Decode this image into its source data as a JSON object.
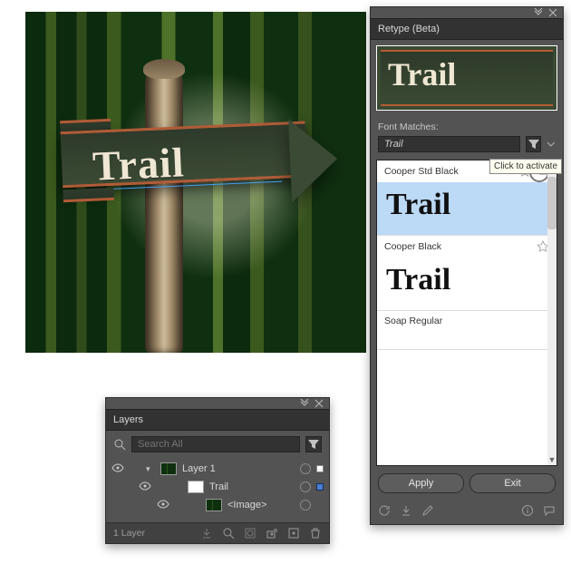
{
  "canvas": {
    "sign_text": "Trail"
  },
  "retype": {
    "title": "Retype (Beta)",
    "preview_text": "Trail",
    "section_label": "Font Matches:",
    "query": "Trail",
    "results": [
      {
        "name": "Cooper Std Black",
        "sample": "Trail",
        "selected": true
      },
      {
        "name": "Cooper Black",
        "sample": "Trail",
        "selected": false
      },
      {
        "name": "Soap Regular",
        "sample": "",
        "selected": false
      }
    ],
    "tooltip": "Click to activate",
    "apply_label": "Apply",
    "exit_label": "Exit"
  },
  "layers": {
    "title": "Layers",
    "search_placeholder": "Search All",
    "items": {
      "root": {
        "label": "Layer 1"
      },
      "child_text": {
        "label": "Trail"
      },
      "child_image": {
        "label": "<Image>"
      }
    },
    "footer_count": "1 Layer"
  }
}
